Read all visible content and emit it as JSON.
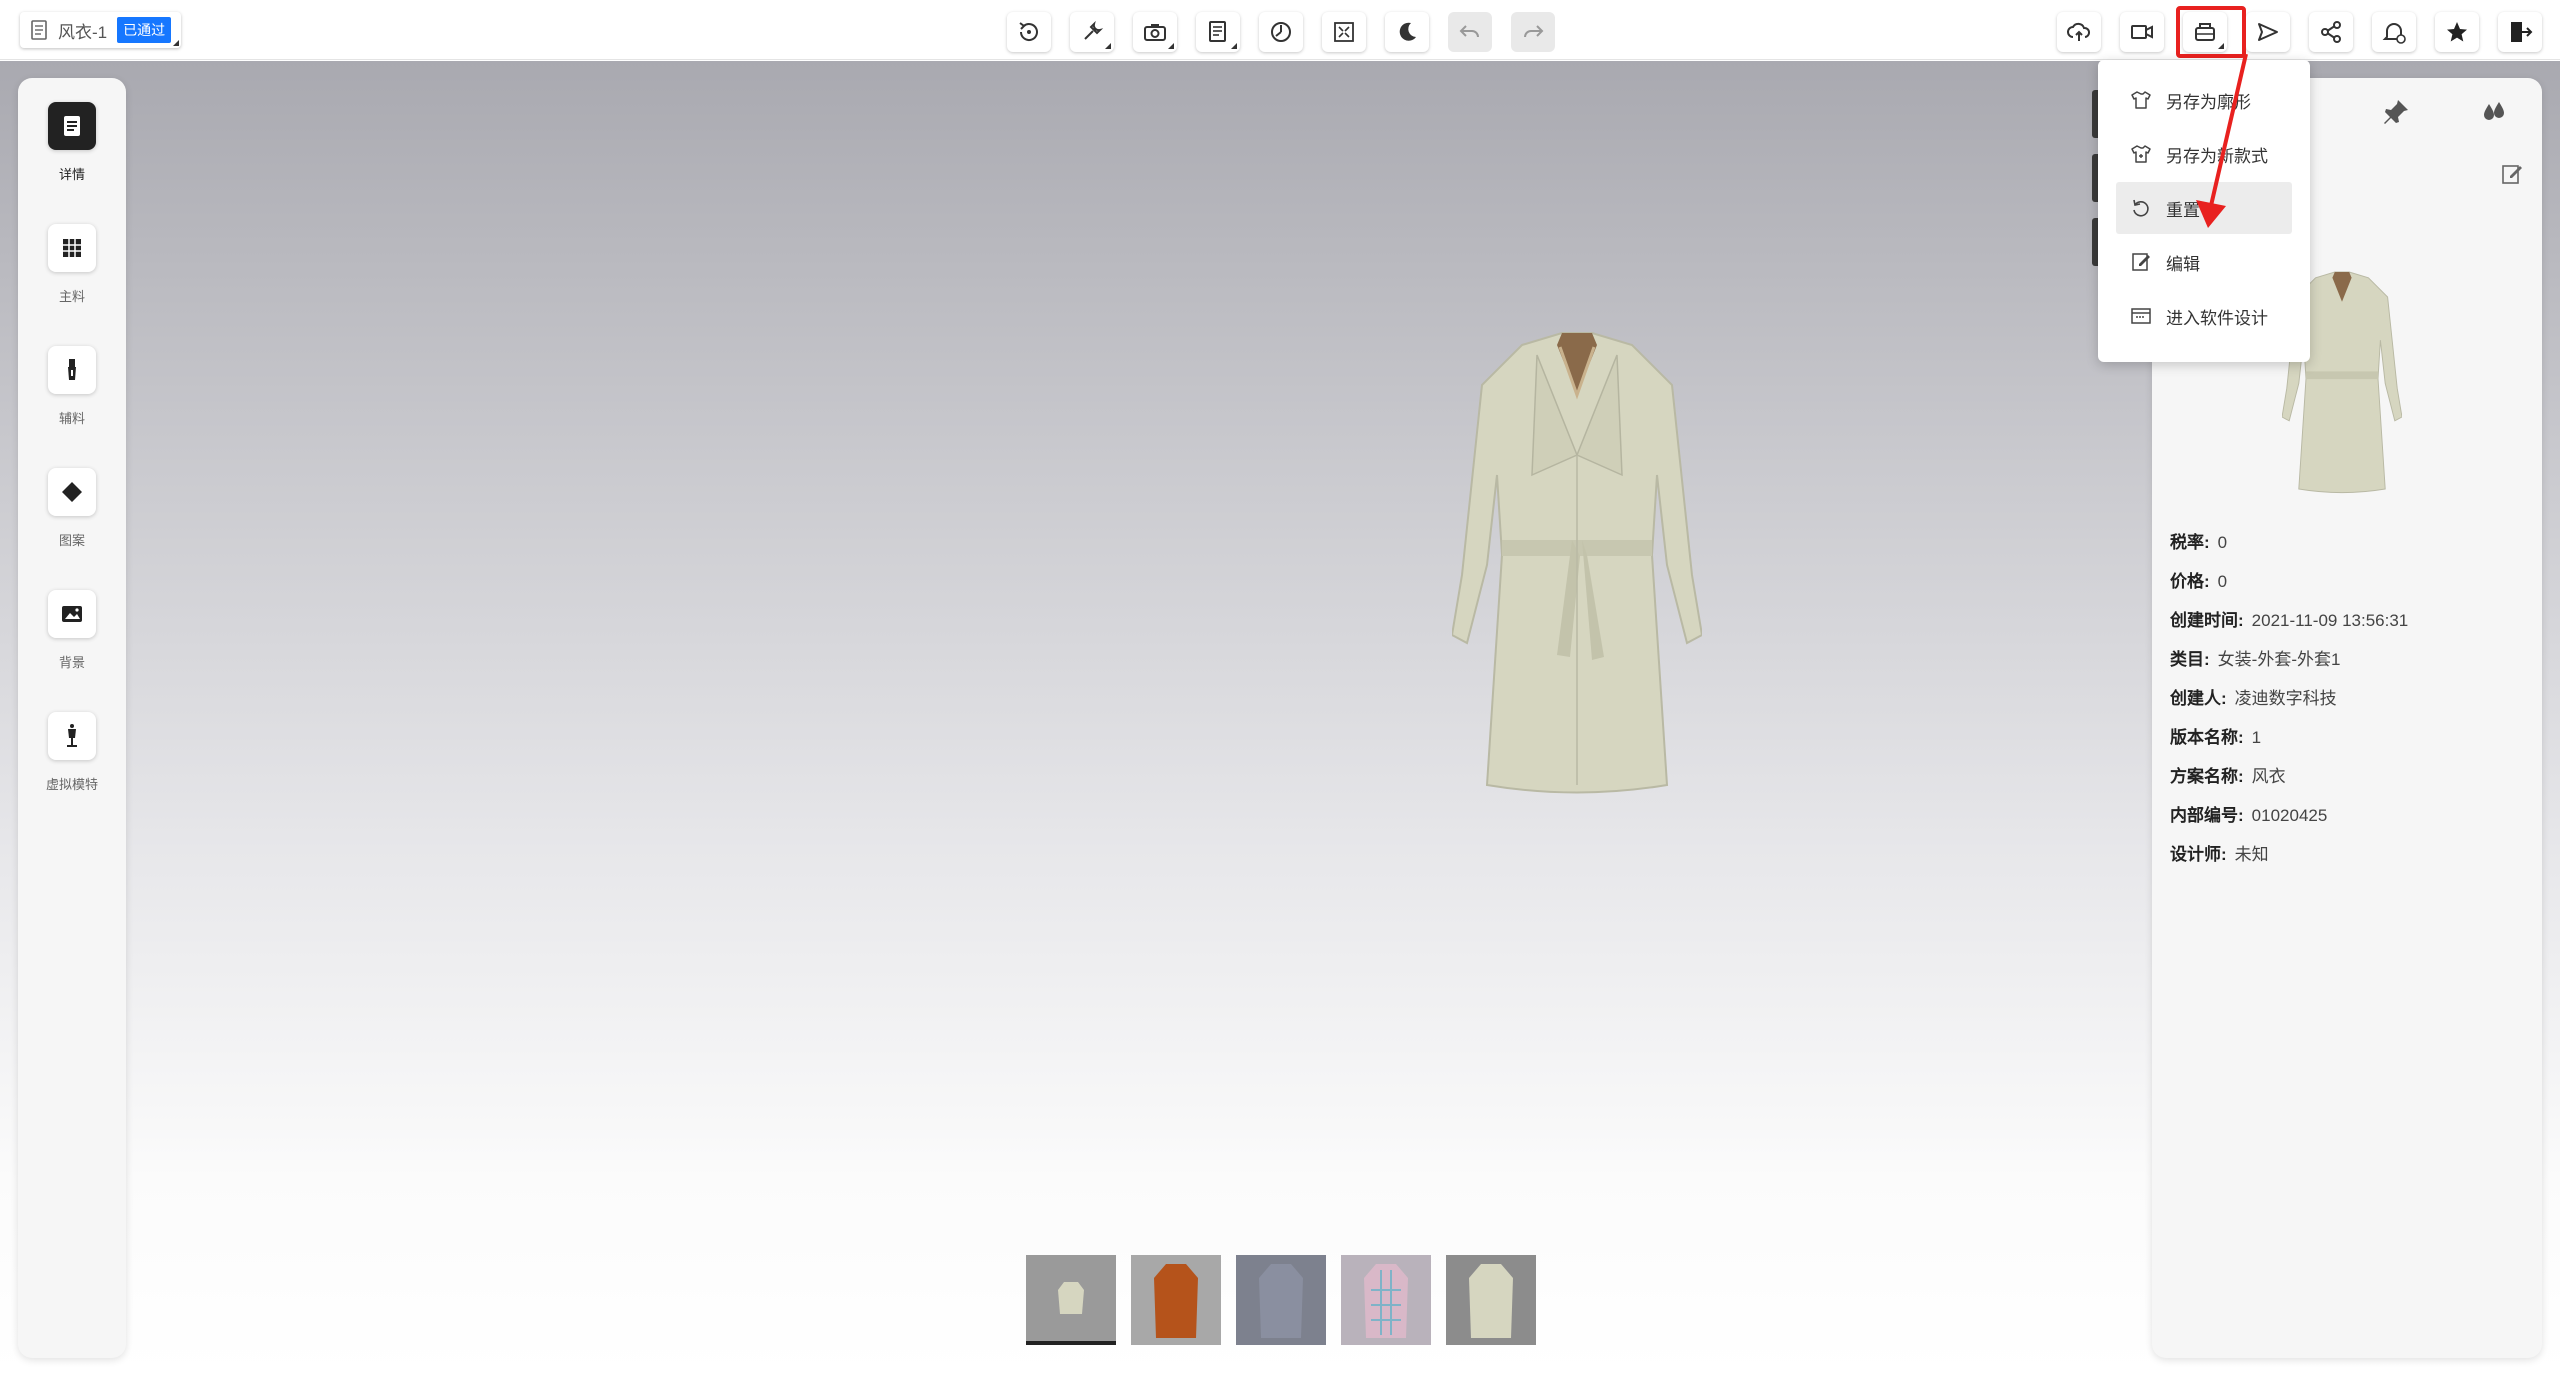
{
  "header": {
    "title": "风衣-1",
    "status_badge": "已通过"
  },
  "toolbar": {
    "center_icons": [
      "rotate-icon",
      "wrench-icon",
      "camera-icon",
      "document-icon",
      "timer-icon",
      "fullscreen-icon",
      "moon-icon",
      "undo-icon",
      "redo-icon"
    ],
    "right_icons": [
      "cloud-upload-icon",
      "video-icon",
      "save-as-icon",
      "send-icon",
      "share-icon",
      "bell-settings-icon",
      "star-icon",
      "exit-icon"
    ]
  },
  "left_sidebar": {
    "items": [
      {
        "label": "详情",
        "icon": "details-icon",
        "active": true
      },
      {
        "label": "主料",
        "icon": "fabric-grid-icon"
      },
      {
        "label": "辅料",
        "icon": "zipper-icon"
      },
      {
        "label": "图案",
        "icon": "pattern-icon"
      },
      {
        "label": "背景",
        "icon": "background-image-icon"
      },
      {
        "label": "虚拟模特",
        "icon": "mannequin-icon"
      }
    ]
  },
  "dropdown": {
    "items": [
      {
        "label": "另存为廓形",
        "icon": "shirt-icon"
      },
      {
        "label": "另存为新款式",
        "icon": "shirt-plus-icon"
      },
      {
        "label": "重置",
        "icon": "reset-icon",
        "hover": true
      },
      {
        "label": "编辑",
        "icon": "edit-icon"
      },
      {
        "label": "进入软件设计",
        "icon": "software-design-icon"
      }
    ]
  },
  "details": {
    "rows": [
      {
        "key": "税率:",
        "value": "0"
      },
      {
        "key": "价格:",
        "value": "0"
      },
      {
        "key": "创建时间:",
        "value": "2021-11-09 13:56:31"
      },
      {
        "key": "类目:",
        "value": "女装-外套-外套1"
      },
      {
        "key": "创建人:",
        "value": "凌迪数字科技"
      },
      {
        "key": "版本名称:",
        "value": "1"
      },
      {
        "key": "方案名称:",
        "value": "风衣"
      },
      {
        "key": "内部编号:",
        "value": "01020425"
      },
      {
        "key": "设计师:",
        "value": "未知"
      }
    ]
  },
  "thumbnails": [
    "trench-coat-small",
    "orange-coat",
    "gray-coat",
    "plaid-coat",
    "beige-trench-coat"
  ],
  "colors": {
    "badge": "#1677ff",
    "highlight": "#e8211f",
    "garment": "#d6d6c0"
  }
}
